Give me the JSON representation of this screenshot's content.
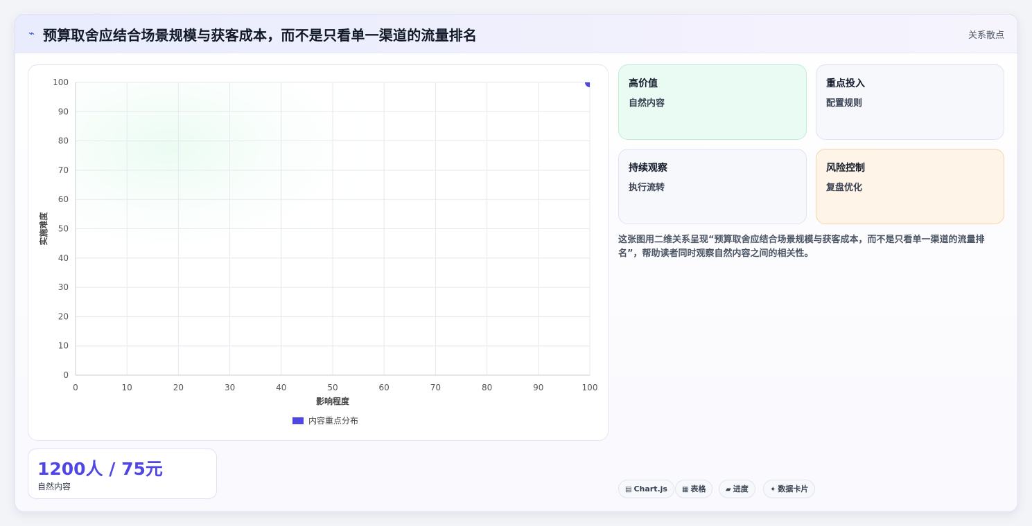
{
  "header": {
    "title": "预算取舍应结合场景规模与获客成本，而不是只看单一渠道的流量排名",
    "tag": "关系散点"
  },
  "quadrants": [
    {
      "title": "高价值",
      "subtitle": "自然内容"
    },
    {
      "title": "重点投入",
      "subtitle": "配置规则"
    },
    {
      "title": "持续观察",
      "subtitle": "执行流转"
    },
    {
      "title": "风险控制",
      "subtitle": "复盘优化"
    }
  ],
  "description": "这张图用二维关系呈现“预算取舍应结合场景规模与获客成本，而不是只看单一渠道的流量排名”，帮助读者同时观察自然内容之间的相关性。",
  "stat": {
    "value": "1200人 / 75元",
    "label": "自然内容"
  },
  "pills": [
    {
      "icon": "chart-icon",
      "glyph": "▤",
      "label": "Chart.js"
    },
    {
      "icon": "table-icon",
      "glyph": "▦",
      "label": "表格"
    },
    {
      "icon": "progress-icon",
      "glyph": "▰",
      "label": "进度"
    },
    {
      "icon": "sparkle-icon",
      "glyph": "✦",
      "label": "数据卡片"
    }
  ],
  "colors": {
    "accent": "#4f46e5",
    "bolt": "#3b5bdb"
  },
  "chart_data": {
    "type": "scatter",
    "xlabel": "影响程度",
    "ylabel": "实施难度",
    "xlim": [
      0,
      100
    ],
    "ylim": [
      0,
      100
    ],
    "xticks": [
      0,
      10,
      20,
      30,
      40,
      50,
      60,
      70,
      80,
      90,
      100
    ],
    "yticks": [
      0,
      10,
      20,
      30,
      40,
      50,
      60,
      70,
      80,
      90,
      100
    ],
    "grid": true,
    "legend_position": "bottom",
    "series": [
      {
        "name": "内容重点分布",
        "color": "#4f46e5",
        "points": [
          {
            "x": 100,
            "y": 100
          }
        ]
      }
    ]
  }
}
